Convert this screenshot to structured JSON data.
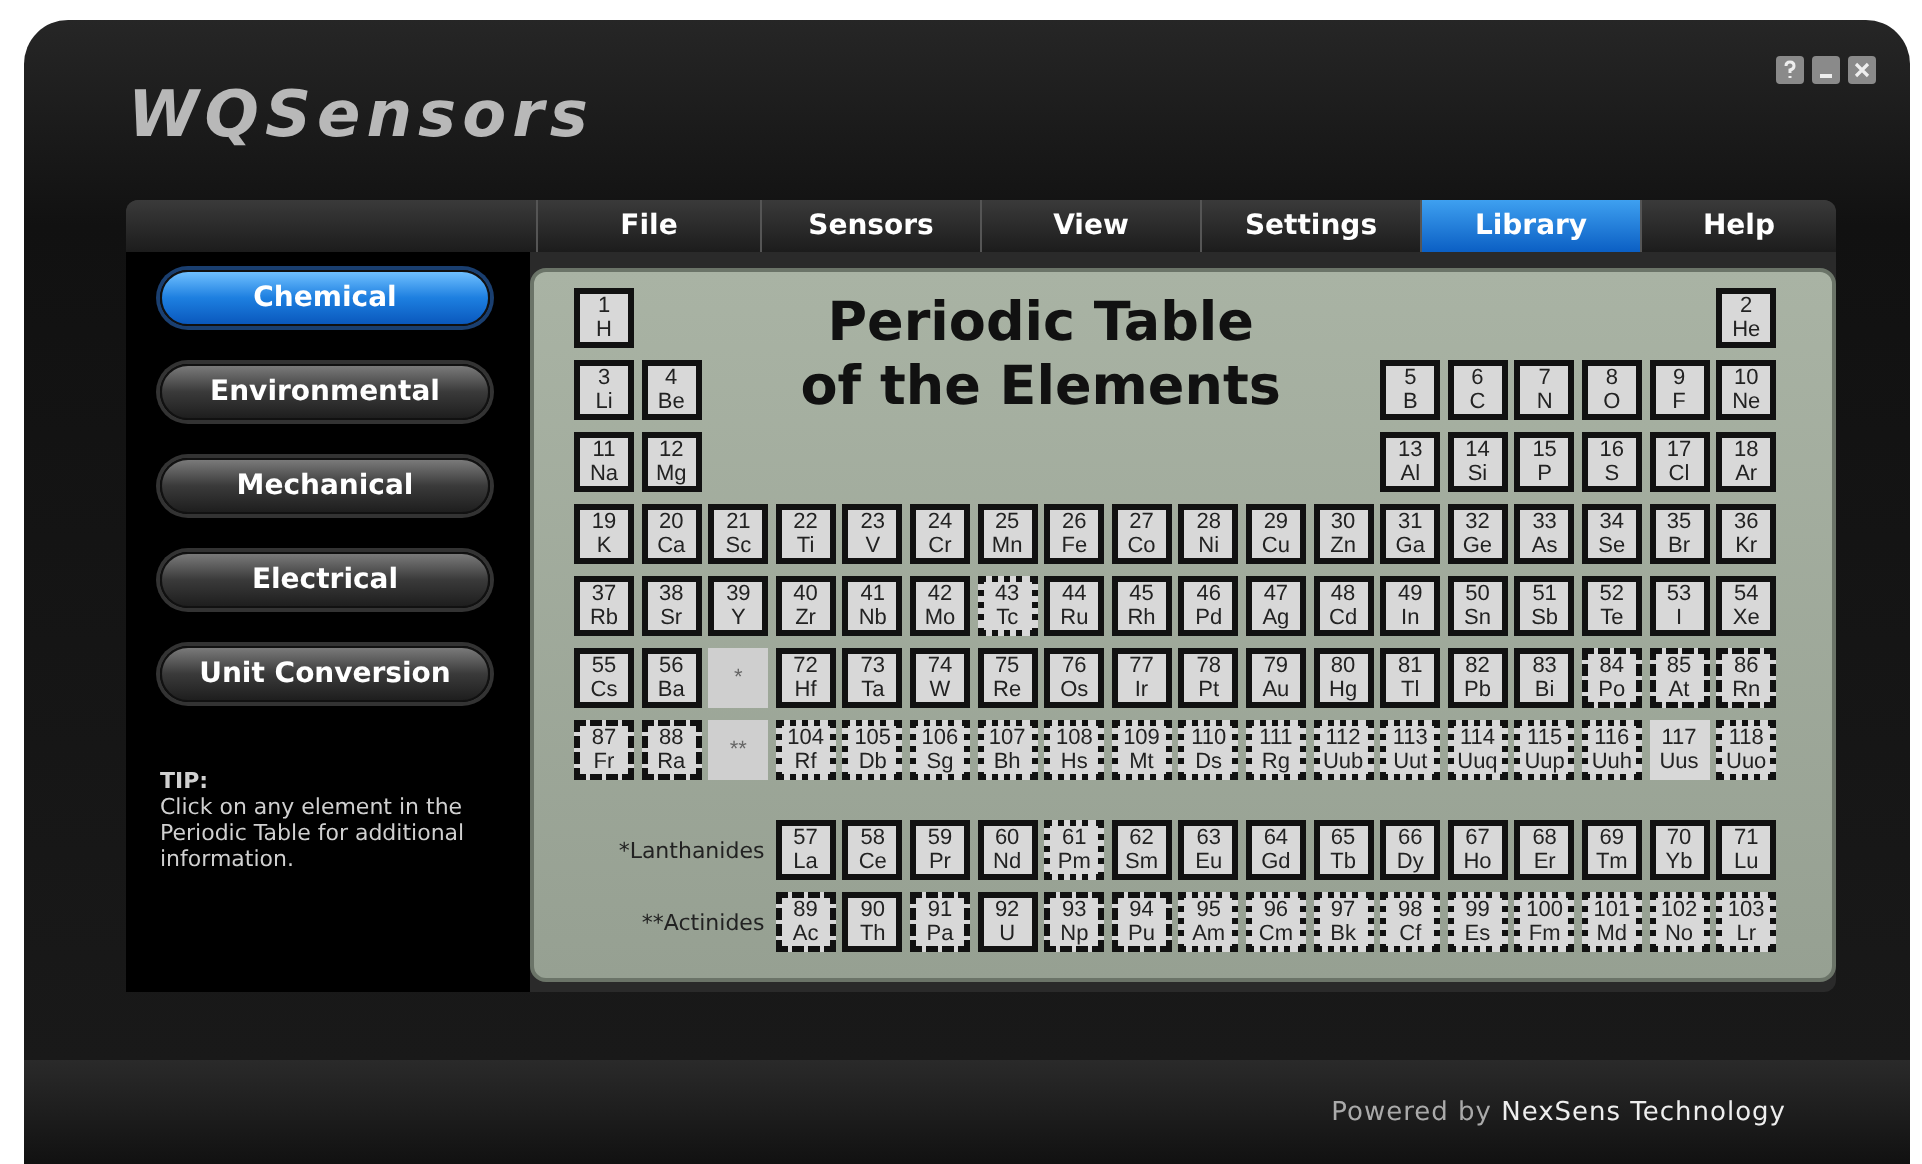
{
  "window": {
    "logo": "WQSensors"
  },
  "menu": [
    {
      "label": "File",
      "selected": false
    },
    {
      "label": "Sensors",
      "selected": false
    },
    {
      "label": "View",
      "selected": false
    },
    {
      "label": "Settings",
      "selected": false
    },
    {
      "label": "Library",
      "selected": true
    },
    {
      "label": "Help",
      "selected": false
    }
  ],
  "sidebar": {
    "items": [
      {
        "label": "Chemical",
        "selected": true
      },
      {
        "label": "Environmental",
        "selected": false
      },
      {
        "label": "Mechanical",
        "selected": false
      },
      {
        "label": "Electrical",
        "selected": false
      },
      {
        "label": "Unit Conversion",
        "selected": false
      }
    ],
    "tip": {
      "heading": "TIP:",
      "text": "Click on any element in the Periodic Table for additional information."
    }
  },
  "periodic_table": {
    "title_lines": [
      "Periodic Table",
      "of the Elements"
    ],
    "rows": [
      {
        "cells": [
          {
            "number": "1",
            "symbol": "H",
            "kind": "solid"
          },
          {
            "kind": "empty"
          },
          {
            "kind": "empty"
          },
          {
            "kind": "empty"
          },
          {
            "kind": "empty"
          },
          {
            "kind": "empty"
          },
          {
            "kind": "empty"
          },
          {
            "kind": "empty"
          },
          {
            "kind": "empty"
          },
          {
            "kind": "empty"
          },
          {
            "kind": "empty"
          },
          {
            "kind": "empty"
          },
          {
            "kind": "empty"
          },
          {
            "kind": "empty"
          },
          {
            "kind": "empty"
          },
          {
            "kind": "empty"
          },
          {
            "kind": "empty"
          },
          {
            "number": "2",
            "symbol": "He",
            "kind": "solid"
          }
        ]
      },
      {
        "cells": [
          {
            "number": "3",
            "symbol": "Li",
            "kind": "solid"
          },
          {
            "number": "4",
            "symbol": "Be",
            "kind": "solid"
          },
          {
            "kind": "empty"
          },
          {
            "kind": "empty"
          },
          {
            "kind": "empty"
          },
          {
            "kind": "empty"
          },
          {
            "kind": "empty"
          },
          {
            "kind": "empty"
          },
          {
            "kind": "empty"
          },
          {
            "kind": "empty"
          },
          {
            "kind": "empty"
          },
          {
            "kind": "empty"
          },
          {
            "number": "5",
            "symbol": "B",
            "kind": "solid"
          },
          {
            "number": "6",
            "symbol": "C",
            "kind": "solid"
          },
          {
            "number": "7",
            "symbol": "N",
            "kind": "solid"
          },
          {
            "number": "8",
            "symbol": "O",
            "kind": "solid"
          },
          {
            "number": "9",
            "symbol": "F",
            "kind": "solid"
          },
          {
            "number": "10",
            "symbol": "Ne",
            "kind": "solid"
          }
        ]
      },
      {
        "cells": [
          {
            "number": "11",
            "symbol": "Na",
            "kind": "solid"
          },
          {
            "number": "12",
            "symbol": "Mg",
            "kind": "solid"
          },
          {
            "kind": "empty"
          },
          {
            "kind": "empty"
          },
          {
            "kind": "empty"
          },
          {
            "kind": "empty"
          },
          {
            "kind": "empty"
          },
          {
            "kind": "empty"
          },
          {
            "kind": "empty"
          },
          {
            "kind": "empty"
          },
          {
            "kind": "empty"
          },
          {
            "kind": "empty"
          },
          {
            "number": "13",
            "symbol": "Al",
            "kind": "solid"
          },
          {
            "number": "14",
            "symbol": "Si",
            "kind": "solid"
          },
          {
            "number": "15",
            "symbol": "P",
            "kind": "solid"
          },
          {
            "number": "16",
            "symbol": "S",
            "kind": "solid"
          },
          {
            "number": "17",
            "symbol": "Cl",
            "kind": "solid"
          },
          {
            "number": "18",
            "symbol": "Ar",
            "kind": "solid"
          }
        ]
      },
      {
        "cells": [
          {
            "number": "19",
            "symbol": "K",
            "kind": "solid"
          },
          {
            "number": "20",
            "symbol": "Ca",
            "kind": "solid"
          },
          {
            "number": "21",
            "symbol": "Sc",
            "kind": "solid"
          },
          {
            "number": "22",
            "symbol": "Ti",
            "kind": "solid"
          },
          {
            "number": "23",
            "symbol": "V",
            "kind": "solid"
          },
          {
            "number": "24",
            "symbol": "Cr",
            "kind": "solid"
          },
          {
            "number": "25",
            "symbol": "Mn",
            "kind": "solid"
          },
          {
            "number": "26",
            "symbol": "Fe",
            "kind": "solid"
          },
          {
            "number": "27",
            "symbol": "Co",
            "kind": "solid"
          },
          {
            "number": "28",
            "symbol": "Ni",
            "kind": "solid"
          },
          {
            "number": "29",
            "symbol": "Cu",
            "kind": "solid"
          },
          {
            "number": "30",
            "symbol": "Zn",
            "kind": "solid"
          },
          {
            "number": "31",
            "symbol": "Ga",
            "kind": "solid"
          },
          {
            "number": "32",
            "symbol": "Ge",
            "kind": "solid"
          },
          {
            "number": "33",
            "symbol": "As",
            "kind": "solid"
          },
          {
            "number": "34",
            "symbol": "Se",
            "kind": "solid"
          },
          {
            "number": "35",
            "symbol": "Br",
            "kind": "solid"
          },
          {
            "number": "36",
            "symbol": "Kr",
            "kind": "solid"
          }
        ]
      },
      {
        "cells": [
          {
            "number": "37",
            "symbol": "Rb",
            "kind": "solid"
          },
          {
            "number": "38",
            "symbol": "Sr",
            "kind": "solid"
          },
          {
            "number": "39",
            "symbol": "Y",
            "kind": "solid"
          },
          {
            "number": "40",
            "symbol": "Zr",
            "kind": "solid"
          },
          {
            "number": "41",
            "symbol": "Nb",
            "kind": "solid"
          },
          {
            "number": "42",
            "symbol": "Mo",
            "kind": "solid"
          },
          {
            "number": "43",
            "symbol": "Tc",
            "kind": "dotted"
          },
          {
            "number": "44",
            "symbol": "Ru",
            "kind": "solid"
          },
          {
            "number": "45",
            "symbol": "Rh",
            "kind": "solid"
          },
          {
            "number": "46",
            "symbol": "Pd",
            "kind": "solid"
          },
          {
            "number": "47",
            "symbol": "Ag",
            "kind": "solid"
          },
          {
            "number": "48",
            "symbol": "Cd",
            "kind": "solid"
          },
          {
            "number": "49",
            "symbol": "In",
            "kind": "solid"
          },
          {
            "number": "50",
            "symbol": "Sn",
            "kind": "solid"
          },
          {
            "number": "51",
            "symbol": "Sb",
            "kind": "solid"
          },
          {
            "number": "52",
            "symbol": "Te",
            "kind": "solid"
          },
          {
            "number": "53",
            "symbol": "I",
            "kind": "solid"
          },
          {
            "number": "54",
            "symbol": "Xe",
            "kind": "solid"
          }
        ]
      },
      {
        "cells": [
          {
            "number": "55",
            "symbol": "Cs",
            "kind": "solid"
          },
          {
            "number": "56",
            "symbol": "Ba",
            "kind": "solid"
          },
          {
            "symbol": "*",
            "kind": "placeholder"
          },
          {
            "number": "72",
            "symbol": "Hf",
            "kind": "solid"
          },
          {
            "number": "73",
            "symbol": "Ta",
            "kind": "solid"
          },
          {
            "number": "74",
            "symbol": "W",
            "kind": "solid"
          },
          {
            "number": "75",
            "symbol": "Re",
            "kind": "solid"
          },
          {
            "number": "76",
            "symbol": "Os",
            "kind": "solid"
          },
          {
            "number": "77",
            "symbol": "Ir",
            "kind": "solid"
          },
          {
            "number": "78",
            "symbol": "Pt",
            "kind": "solid"
          },
          {
            "number": "79",
            "symbol": "Au",
            "kind": "solid"
          },
          {
            "number": "80",
            "symbol": "Hg",
            "kind": "solid"
          },
          {
            "number": "81",
            "symbol": "Tl",
            "kind": "solid"
          },
          {
            "number": "82",
            "symbol": "Pb",
            "kind": "solid"
          },
          {
            "number": "83",
            "symbol": "Bi",
            "kind": "solid"
          },
          {
            "number": "84",
            "symbol": "Po",
            "kind": "dashed"
          },
          {
            "number": "85",
            "symbol": "At",
            "kind": "dashed"
          },
          {
            "number": "86",
            "symbol": "Rn",
            "kind": "dashed"
          }
        ]
      },
      {
        "cells": [
          {
            "number": "87",
            "symbol": "Fr",
            "kind": "dashed"
          },
          {
            "number": "88",
            "symbol": "Ra",
            "kind": "dashed"
          },
          {
            "symbol": "**",
            "kind": "placeholder"
          },
          {
            "number": "104",
            "symbol": "Rf",
            "kind": "dotted"
          },
          {
            "number": "105",
            "symbol": "Db",
            "kind": "dotted"
          },
          {
            "number": "106",
            "symbol": "Sg",
            "kind": "dotted"
          },
          {
            "number": "107",
            "symbol": "Bh",
            "kind": "dotted"
          },
          {
            "number": "108",
            "symbol": "Hs",
            "kind": "dotted"
          },
          {
            "number": "109",
            "symbol": "Mt",
            "kind": "dotted"
          },
          {
            "number": "110",
            "symbol": "Ds",
            "kind": "dotted"
          },
          {
            "number": "111",
            "symbol": "Rg",
            "kind": "dotted"
          },
          {
            "number": "112",
            "symbol": "Uub",
            "kind": "dotted"
          },
          {
            "number": "113",
            "symbol": "Uut",
            "kind": "dotted"
          },
          {
            "number": "114",
            "symbol": "Uuq",
            "kind": "dotted"
          },
          {
            "number": "115",
            "symbol": "Uup",
            "kind": "dotted"
          },
          {
            "number": "116",
            "symbol": "Uuh",
            "kind": "dotted"
          },
          {
            "number": "117",
            "symbol": "Uus",
            "kind": "none"
          },
          {
            "number": "118",
            "symbol": "Uuo",
            "kind": "dotted"
          }
        ]
      }
    ],
    "series": [
      {
        "label": "*Lanthanides",
        "cells": [
          {
            "number": "57",
            "symbol": "La",
            "kind": "solid"
          },
          {
            "number": "58",
            "symbol": "Ce",
            "kind": "solid"
          },
          {
            "number": "59",
            "symbol": "Pr",
            "kind": "solid"
          },
          {
            "number": "60",
            "symbol": "Nd",
            "kind": "solid"
          },
          {
            "number": "61",
            "symbol": "Pm",
            "kind": "dotted"
          },
          {
            "number": "62",
            "symbol": "Sm",
            "kind": "solid"
          },
          {
            "number": "63",
            "symbol": "Eu",
            "kind": "solid"
          },
          {
            "number": "64",
            "symbol": "Gd",
            "kind": "solid"
          },
          {
            "number": "65",
            "symbol": "Tb",
            "kind": "solid"
          },
          {
            "number": "66",
            "symbol": "Dy",
            "kind": "solid"
          },
          {
            "number": "67",
            "symbol": "Ho",
            "kind": "solid"
          },
          {
            "number": "68",
            "symbol": "Er",
            "kind": "solid"
          },
          {
            "number": "69",
            "symbol": "Tm",
            "kind": "solid"
          },
          {
            "number": "70",
            "symbol": "Yb",
            "kind": "solid"
          },
          {
            "number": "71",
            "symbol": "Lu",
            "kind": "solid"
          }
        ]
      },
      {
        "label": "**Actinides",
        "cells": [
          {
            "number": "89",
            "symbol": "Ac",
            "kind": "dashed"
          },
          {
            "number": "90",
            "symbol": "Th",
            "kind": "solid"
          },
          {
            "number": "91",
            "symbol": "Pa",
            "kind": "dashed"
          },
          {
            "number": "92",
            "symbol": "U",
            "kind": "solid"
          },
          {
            "number": "93",
            "symbol": "Np",
            "kind": "dashed"
          },
          {
            "number": "94",
            "symbol": "Pu",
            "kind": "dashed"
          },
          {
            "number": "95",
            "symbol": "Am",
            "kind": "dotted"
          },
          {
            "number": "96",
            "symbol": "Cm",
            "kind": "dotted"
          },
          {
            "number": "97",
            "symbol": "Bk",
            "kind": "dotted"
          },
          {
            "number": "98",
            "symbol": "Cf",
            "kind": "dotted"
          },
          {
            "number": "99",
            "symbol": "Es",
            "kind": "dotted"
          },
          {
            "number": "100",
            "symbol": "Fm",
            "kind": "dotted"
          },
          {
            "number": "101",
            "symbol": "Md",
            "kind": "dotted"
          },
          {
            "number": "102",
            "symbol": "No",
            "kind": "dotted"
          },
          {
            "number": "103",
            "symbol": "Lr",
            "kind": "dotted"
          }
        ]
      }
    ]
  },
  "footer": {
    "text": "Powered by **NexSens Technology**"
  }
}
